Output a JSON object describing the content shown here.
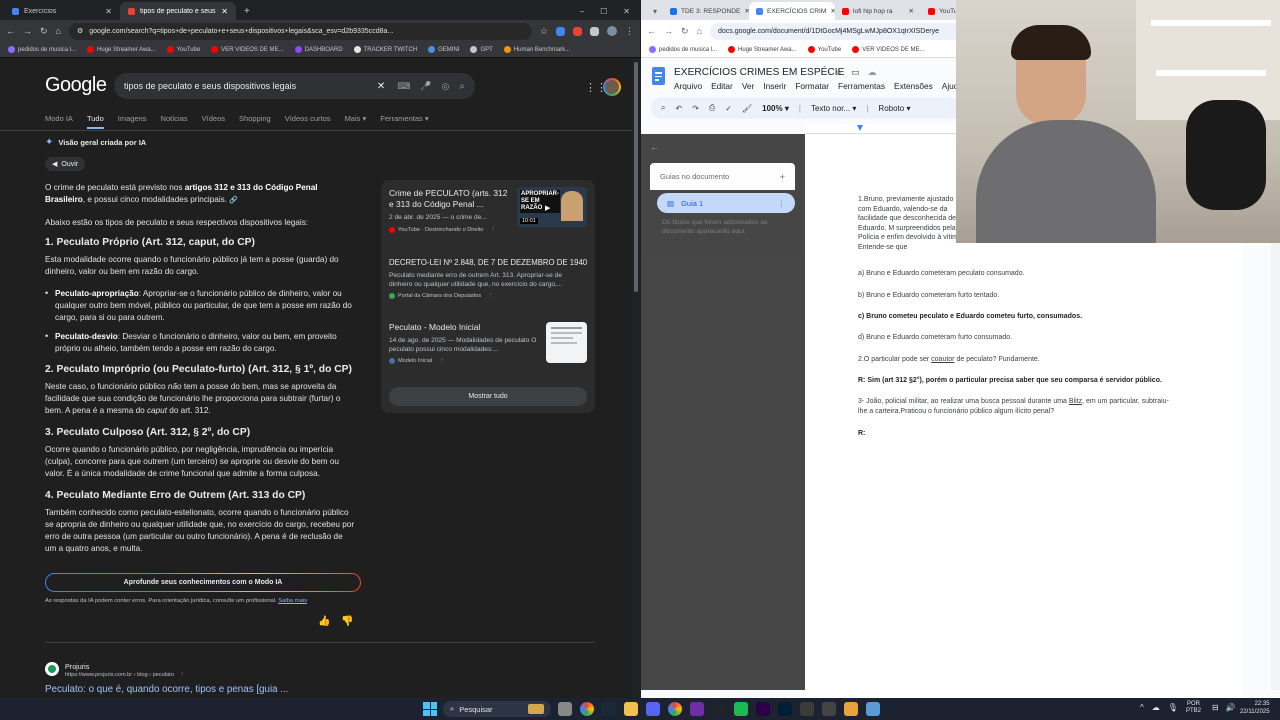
{
  "left_browser": {
    "tabs": [
      {
        "title": "Exercícios",
        "color": "#4285f4"
      },
      {
        "title": "tipos de peculato e seus dispo",
        "color": "#ea4335"
      }
    ],
    "address": "google.com/search?q=tipos+de+peculato+e+seus+dispositivos+legais&sca_esv=d2b9335ccd8a...",
    "bookmarks": [
      "pedidos de musica l...",
      "Huge Streamer Awa...",
      "YouTube",
      "VER VIDEOS DE ME...",
      "DASHBOARD",
      "TRACKER TWITCH",
      "GEMINI",
      "GPT",
      "Human Benchmark..."
    ]
  },
  "google": {
    "logo": "Google",
    "query": "tipos de peculato e seus dispositivos legais",
    "nav": [
      "Modo IA",
      "Tudo",
      "Imagens",
      "Notícias",
      "Vídeos",
      "Shopping",
      "Vídeos curtos",
      "Mais ▾",
      "Ferramentas ▾"
    ],
    "ai_header": "Visão geral criada por IA",
    "listen": "Ouvir",
    "intro_a": "O crime de peculato está previsto nos ",
    "intro_b": "artigos 312 e 313 do Código Penal Brasileiro",
    "intro_c": ", e possui cinco modalidades principais.",
    "intro2": "Abaixo estão os tipos de peculato e seus respectivos dispositivos legais:",
    "h1": "1. Peculato Próprio (Art. 312, caput, do CP)",
    "p1": "Esta modalidade ocorre quando o funcionário público já tem a posse (guarda) do dinheiro, valor ou bem em razão do cargo.",
    "b1_label": "Peculato-apropriação",
    "b1_text": ": Apropriar-se o funcionário público de dinheiro, valor ou qualquer outro bem móvel, público ou particular, de que tem a posse em razão do cargo, para si ou para outrem.",
    "b2_label": "Peculato-desvio",
    "b2_text": ": Desviar o funcionário o dinheiro, valor ou bem, em proveito próprio ou alheio, também tendo a posse em razão do cargo.",
    "h2": "2. Peculato Impróprio (ou Peculato-furto) (Art. 312, § 1º, do CP)",
    "p2_a": "Neste caso, o funcionário público ",
    "p2_i": "não",
    "p2_b": " tem a posse do bem, mas se aproveita da facilidade que sua condição de funcionário lhe proporciona para subtrair (furtar) o bem. A pena é a mesma do ",
    "p2_i2": "caput",
    "p2_c": " do art. 312.",
    "h3": "3. Peculato Culposo (Art. 312, § 2º, do CP)",
    "p3": "Ocorre quando o funcionário público, por negligência, imprudência ou imperícia (culpa), concorre para que outrem (um terceiro) se aproprie ou desvie do bem ou valor. É a única modalidade de crime funcional que admite a forma culposa.",
    "h4": "4. Peculato Mediante Erro de Outrem (Art. 313 do CP)",
    "p4": "Também conhecido como peculato-estelionato, ocorre quando o funcionário público se apropria de dinheiro ou qualquer utilidade que, no exercício do cargo, recebeu por erro de outra pessoa (um particular ou outro funcionário). A pena é de reclusão de um a quatro anos, e multa.",
    "deepen": "Aprofunde seus conhecimentos com o Modo IA",
    "disclaimer": "As respostas da IA podem conter erros. Para orientação jurídica, consulte um profissional.",
    "learn_more": "Saiba mais",
    "sources": [
      {
        "title": "Crime de PECULATO (arts. 312 e 313 do Código Penal ...",
        "snippet": "2 de abr. de 2025 — o crime de...",
        "source": "YouTube · Destrinchando o Direito",
        "thumb_text": "APROPRIAR-SE EM RAZÃO",
        "thumb_time": "10:01"
      },
      {
        "title": "DECRETO-LEI Nº 2.848, DE 7 DE DEZEMBRO DE 1940",
        "snippet": "Peculato mediante erro de outrem Art. 313. Apropriar-se de dinheiro ou qualquer utilidade que, no exercício do cargo,...",
        "source": "Portal da Câmara dos Deputados"
      },
      {
        "title": "Peculato - Modelo Inicial",
        "snippet": "14 de ago. de 2025 — Modalidades de peculato O peculato possui cinco modalidades:...",
        "source": "Modelo Inicial"
      }
    ],
    "show_all": "Mostrar tudo",
    "result_site": "Projuris",
    "result_url": "https://www.projuris.com.br › blog › peculato",
    "result_title": "Peculato: o que é, quando ocorre, tipos e penas [guia ..."
  },
  "right_browser": {
    "tabs": [
      {
        "title": "TDE 3: RESPONDE",
        "color": "#1a73e8"
      },
      {
        "title": "EXERCÍCIOS CRIM",
        "color": "#4285f4"
      },
      {
        "title": "lofi hip hop ra",
        "color": "#ff0000"
      },
      {
        "title": "YouTube",
        "color": "#ff0000"
      }
    ],
    "address": "docs.google.com/document/d/1DtGocMj4MSgLwMJp8OX1qIrXISDerye",
    "bookmarks": [
      "pedidos de musica l...",
      "Huge Streamer Awa...",
      "YouTube",
      "VER VIDEOS DE ME..."
    ]
  },
  "docs": {
    "title": "EXERCÍCIOS CRIMES EM ESPÉCIE",
    "menu": [
      "Arquivo",
      "Editar",
      "Ver",
      "Inserir",
      "Formatar",
      "Ferramentas",
      "Extensões",
      "Ajuda"
    ],
    "zoom": "100%",
    "style": "Texto nor...",
    "font": "Roboto",
    "outline_title": "Guias no documento",
    "tab_name": "Guia 1",
    "outline_hint": "Os títulos que forem adicionados ao documento aparecerão aqui.",
    "q1": "1.Bruno, previamente ajustado com Eduardo, valendo-se da facilidade que desconhecida de Eduardo. M surpreendidos pela Polícia e enfim devolvido à vítima. Entende-se que",
    "opt_a": "a) Bruno e Eduardo cometeram peculato consumado.",
    "opt_b": "b) Bruno e Eduardo cometeram furto tentado.",
    "opt_c": "c) Bruno cometeu peculato e Eduardo cometeu furto, consumados.",
    "opt_d": "d) Bruno e Eduardo cometeram furto consumado.",
    "q2_a": "2.O particular pode ser ",
    "q2_u": "coautor",
    "q2_b": " de peculato? Fundamente.",
    "a2": "R: Sim (art 312 §2°), porém o particular precisa saber que seu comparsa é servidor público.",
    "q3_a": "3- João, policial militar, ao realizar uma busca pessoal durante uma ",
    "q3_u": "Blitz",
    "q3_b": ", em um particular, subtraiu-lhe a carteira.Praticou o funcionário público algum ilícito penal?",
    "a3": "R:"
  },
  "taskbar": {
    "search": "Pesquisar",
    "lang": "POR",
    "layout": "PTB2",
    "time": "22:35",
    "date": "22/11/2025"
  }
}
